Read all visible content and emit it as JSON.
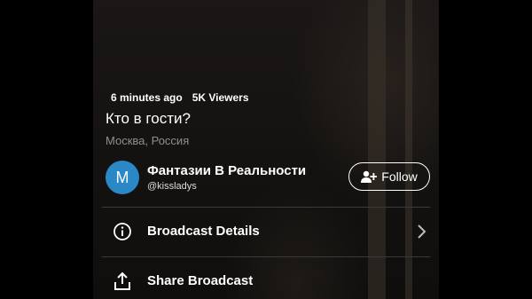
{
  "broadcast": {
    "time_ago": "6 minutes ago",
    "viewers": "5K Viewers",
    "title": "Кто в гости?",
    "location": "Москва, Россия"
  },
  "broadcaster": {
    "avatar_letter": "M",
    "avatar_color": "#2a88c6",
    "name": "Фантазии В Реальности",
    "handle": "@kissladys"
  },
  "follow_button": {
    "label": "Follow",
    "icon": "add-person-icon"
  },
  "menu": {
    "items": [
      {
        "label": "Broadcast Details",
        "icon": "info-icon"
      },
      {
        "label": "Share Broadcast",
        "icon": "share-icon"
      }
    ]
  }
}
